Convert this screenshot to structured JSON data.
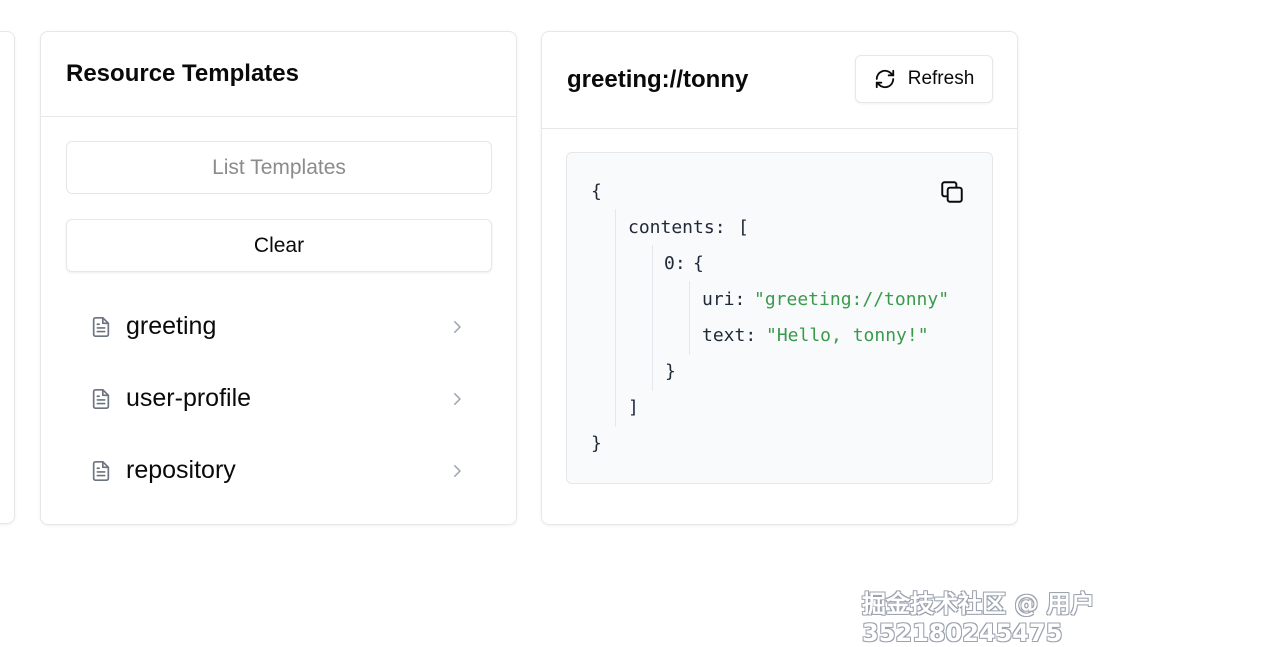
{
  "templates_panel": {
    "title": "Resource Templates",
    "list_button": "List Templates",
    "clear_button": "Clear",
    "items": [
      {
        "label": "greeting"
      },
      {
        "label": "user-profile"
      },
      {
        "label": "repository"
      }
    ]
  },
  "resource_panel": {
    "title": "greeting://tonny",
    "refresh_button": "Refresh",
    "json": {
      "open_brace": "{",
      "contents_key": "contents:",
      "open_bracket": "[",
      "index_key": "0:",
      "index_open": "{",
      "uri_key": "uri:",
      "uri_value": "\"greeting://tonny\"",
      "text_key": "text:",
      "text_value": "\"Hello, tonny!\"",
      "index_close": "}",
      "close_bracket": "]",
      "close_brace": "}"
    }
  },
  "watermark": "掘金技术社区 @ 用户352180245475",
  "colors": {
    "string_value": "#3a9a4b",
    "border": "#e5e7eb",
    "code_bg": "#f8fafc"
  },
  "icons": {
    "template_item": "file-text-icon",
    "chevron": "chevron-right-icon",
    "refresh": "refresh-icon",
    "copy": "copy-icon"
  }
}
